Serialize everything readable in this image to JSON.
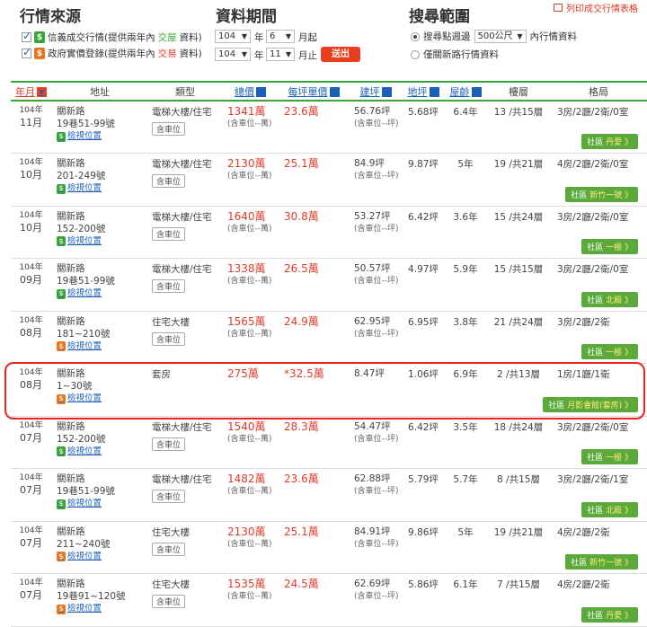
{
  "header": {
    "sources_title": "行情來源",
    "period_title": "資料期間",
    "range_title": "搜尋範圍",
    "print_label": "列印成交行情表格"
  },
  "sources": [
    {
      "text": "信義成交行情(提供兩年內",
      "hl": "交屋",
      "tail": "資料)",
      "checked": true
    },
    {
      "text": "政府實價登錄(提供兩年內",
      "hl": "交易",
      "tail": "資料)",
      "checked": true
    }
  ],
  "period": {
    "start_year": "104",
    "start_month": "6",
    "end_year": "104",
    "end_month": "11",
    "unit_year": "年",
    "start_suffix": "月起",
    "end_suffix": "月止",
    "submit": "送出"
  },
  "range": {
    "opt1_prefix": "搜尋點週邊",
    "opt1_select": "500公尺",
    "opt1_suffix": "內行情資料",
    "opt2": "僅關新路行情資料"
  },
  "columns": [
    "年月",
    "地址",
    "類型",
    "總價",
    "每坪單價",
    "建坪",
    "地坪",
    "屋齡",
    "樓層",
    "格局"
  ],
  "rows": [
    {
      "y": "104年",
      "m": "11月",
      "addr1": "關新路",
      "addr2": "19巷51-99號",
      "src": "g",
      "map": "檢視位置",
      "type": "電梯大樓/住宅",
      "park": "含車位",
      "price": "1341萬",
      "sub": "(含車位--萬)",
      "unit": "23.6萬",
      "bld": "56.76坪",
      "bsub": "(含車位--坪)",
      "land": "5.68坪",
      "age": "6.4年",
      "floor": "13 /共15層",
      "layout": "3房/2廳/2衛/0室",
      "comm": "社區",
      "comm_name": "丹愛 》"
    },
    {
      "y": "104年",
      "m": "10月",
      "addr1": "關新路",
      "addr2": "201-249號",
      "src": "g",
      "map": "檢視位置",
      "type": "電梯大樓/住宅",
      "park": "含車位",
      "price": "2130萬",
      "sub": "(含車位--萬)",
      "unit": "25.1萬",
      "bld": "84.9坪",
      "bsub": "(含車位--坪)",
      "land": "9.87坪",
      "age": "5年",
      "floor": "19 /共21層",
      "layout": "4房/2廳/2衛/0室",
      "comm": "社區",
      "comm_name": "新竹一號 》"
    },
    {
      "y": "104年",
      "m": "10月",
      "addr1": "關新路",
      "addr2": "152-200號",
      "src": "g",
      "map": "檢視位置",
      "type": "電梯大樓/住宅",
      "park": "含車位",
      "price": "1640萬",
      "sub": "(含車位--萬)",
      "unit": "30.8萬",
      "bld": "53.27坪",
      "bsub": "(含車位--坪)",
      "land": "6.42坪",
      "age": "3.6年",
      "floor": "15 /共24層",
      "layout": "3房/2廳/2衛/0室",
      "comm": "社區",
      "comm_name": "一極 》"
    },
    {
      "y": "104年",
      "m": "09月",
      "addr1": "關新路",
      "addr2": "19巷51-99號",
      "src": "g",
      "map": "檢視位置",
      "type": "電梯大樓/住宅",
      "park": "含車位",
      "price": "1338萬",
      "sub": "(含車位--萬)",
      "unit": "26.5萬",
      "bld": "50.57坪",
      "bsub": "(含車位--坪)",
      "land": "4.97坪",
      "age": "5.9年",
      "floor": "15 /共15層",
      "layout": "3房/2廳/2衛/0室",
      "comm": "社區",
      "comm_name": "北殿 》"
    },
    {
      "y": "104年",
      "m": "08月",
      "addr1": "關新路",
      "addr2": "181~210號",
      "src": "o",
      "map": "檢視位置",
      "type": "住宅大樓",
      "park": "含車位",
      "price": "1565萬",
      "sub": "(含車位--萬)",
      "unit": "24.9萬",
      "bld": "62.95坪",
      "bsub": "(含車位--坪)",
      "land": "6.95坪",
      "age": "3.8年",
      "floor": "21 /共24層",
      "layout": "3房/2廳/2衛",
      "comm": "社區",
      "comm_name": "一極 》"
    },
    {
      "y": "104年",
      "m": "08月",
      "addr1": "關新路",
      "addr2": "1~30號",
      "src": "o",
      "map": "檢視位置",
      "type": "套房",
      "park": "",
      "price": "275萬",
      "sub": "",
      "unit": "*32.5萬",
      "bld": "8.47坪",
      "bsub": "",
      "land": "1.06坪",
      "age": "6.9年",
      "floor": "2 /共13層",
      "layout": "1房/1廳/1衛",
      "comm": "社區",
      "comm_name": "月影會館(套房) 》"
    },
    {
      "y": "104年",
      "m": "07月",
      "addr1": "關新路",
      "addr2": "152-200號",
      "src": "g",
      "map": "檢視位置",
      "type": "電梯大樓/住宅",
      "park": "含車位",
      "price": "1540萬",
      "sub": "(含車位--萬)",
      "unit": "28.3萬",
      "bld": "54.47坪",
      "bsub": "(含車位--坪)",
      "land": "6.42坪",
      "age": "3.5年",
      "floor": "18 /共24層",
      "layout": "3房/2廳/2衛/0室",
      "comm": "社區",
      "comm_name": "一極 》"
    },
    {
      "y": "104年",
      "m": "07月",
      "addr1": "關新路",
      "addr2": "19巷51-99號",
      "src": "g",
      "map": "檢視位置",
      "type": "電梯大樓/住宅",
      "park": "含車位",
      "price": "1482萬",
      "sub": "(含車位--萬)",
      "unit": "23.6萬",
      "bld": "62.88坪",
      "bsub": "(含車位--坪)",
      "land": "5.79坪",
      "age": "5.7年",
      "floor": "8 /共15層",
      "layout": "3房/2廳/2衛/1室",
      "comm": "社區",
      "comm_name": "北殿 》"
    },
    {
      "y": "104年",
      "m": "07月",
      "addr1": "關新路",
      "addr2": "211~240號",
      "src": "o",
      "map": "檢視位置",
      "type": "住宅大樓",
      "park": "含車位",
      "price": "2130萬",
      "sub": "(含車位--萬)",
      "unit": "25.1萬",
      "bld": "84.91坪",
      "bsub": "(含車位--坪)",
      "land": "9.86坪",
      "age": "5年",
      "floor": "19 /共21層",
      "layout": "4房/2廳/2衛",
      "comm": "社區",
      "comm_name": "新竹一號 》"
    },
    {
      "y": "104年",
      "m": "07月",
      "addr1": "關新路",
      "addr2": "19巷91~120號",
      "src": "o",
      "map": "檢視位置",
      "type": "住宅大樓",
      "park": "含車位",
      "price": "1535萬",
      "sub": "(含車位--萬)",
      "unit": "24.5萬",
      "bld": "62.69坪",
      "bsub": "(含車位--坪)",
      "land": "5.86坪",
      "age": "6.1年",
      "floor": "7 /共15層",
      "layout": "4房/2廳/2衛",
      "comm": "社區",
      "comm_name": "丹愛 》"
    }
  ]
}
